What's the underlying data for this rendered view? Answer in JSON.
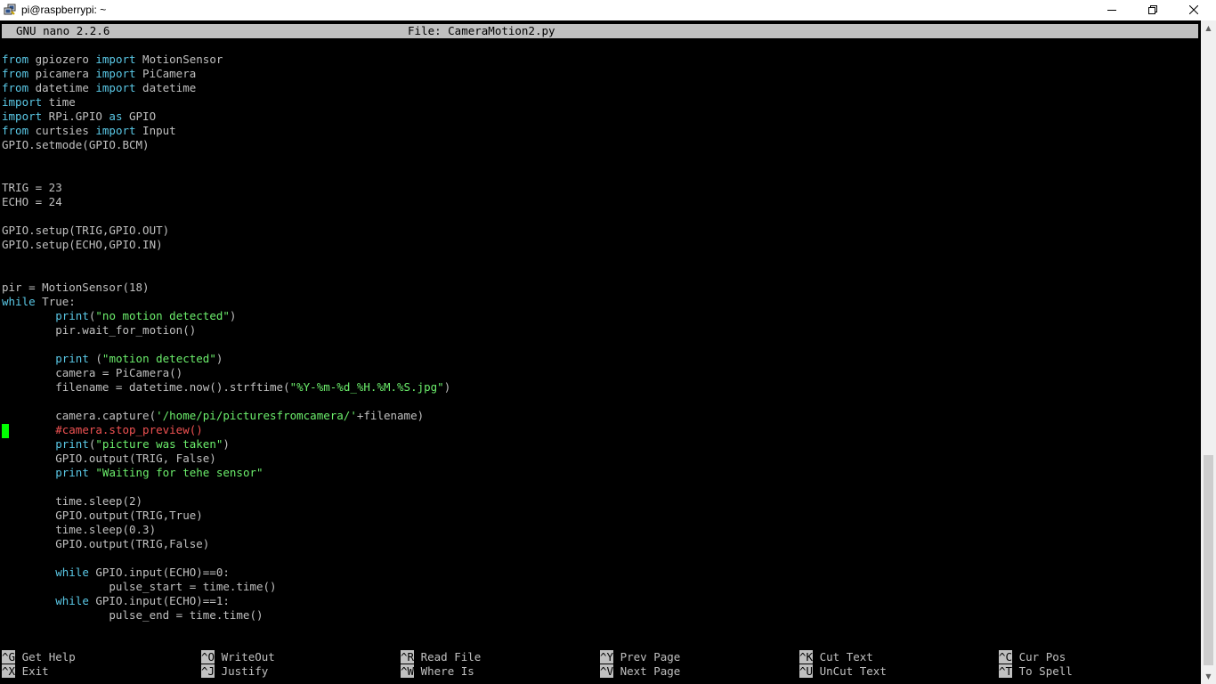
{
  "window": {
    "title": "pi@raspberrypi: ~",
    "icon": "putty-icon",
    "buttons": {
      "minimize": "minimize-icon",
      "maximize": "restore-icon",
      "close": "close-icon"
    }
  },
  "nano": {
    "version": "GNU nano 2.2.6",
    "file_label": "File: CameraMotion2.py"
  },
  "code_lines": [
    "from gpiozero import MotionSensor",
    "from picamera import PiCamera",
    "from datetime import datetime",
    "import time",
    "import RPi.GPIO as GPIO",
    "from curtsies import Input",
    "GPIO.setmode(GPIO.BCM)",
    "",
    "",
    "TRIG = 23",
    "ECHO = 24",
    "",
    "GPIO.setup(TRIG,GPIO.OUT)",
    "GPIO.setup(ECHO,GPIO.IN)",
    "",
    "",
    "pir = MotionSensor(18)",
    "while True:",
    "        print(\"no motion detected\")",
    "        pir.wait_for_motion()",
    "",
    "        print (\"motion detected\")",
    "        camera = PiCamera()",
    "        filename = datetime.now().strftime(\"%Y-%m-%d_%H.%M.%S.jpg\")",
    "",
    "        camera.capture('/home/pi/picturesfromcamera/'+filename)",
    "        #camera.stop_preview()",
    "        print(\"picture was taken\")",
    "        GPIO.output(TRIG, False)",
    "        print \"Waiting for tehe sensor\"",
    "",
    "        time.sleep(2)",
    "        GPIO.output(TRIG,True)",
    "        time.sleep(0.3)",
    "        GPIO.output(TRIG,False)",
    "",
    "        while GPIO.input(ECHO)==0:",
    "                pulse_start = time.time()",
    "        while GPIO.input(ECHO)==1:",
    "                pulse_end = time.time()"
  ],
  "shortcuts": [
    {
      "key": "^G",
      "label": "Get Help"
    },
    {
      "key": "^X",
      "label": "Exit"
    },
    {
      "key": "^O",
      "label": "WriteOut"
    },
    {
      "key": "^J",
      "label": "Justify"
    },
    {
      "key": "^R",
      "label": "Read File"
    },
    {
      "key": "^W",
      "label": "Where Is"
    },
    {
      "key": "^Y",
      "label": "Prev Page"
    },
    {
      "key": "^V",
      "label": "Next Page"
    },
    {
      "key": "^K",
      "label": "Cut Text"
    },
    {
      "key": "^U",
      "label": "UnCut Text"
    },
    {
      "key": "^C",
      "label": "Cur Pos"
    },
    {
      "key": "^T",
      "label": "To Spell"
    }
  ],
  "colors": {
    "keyword": "#5ac8e6",
    "string": "#6cef6c",
    "comment": "#f05252",
    "text": "#c0c0c0",
    "cursor": "#00ff00",
    "header_bg": "#c0c0c0"
  }
}
